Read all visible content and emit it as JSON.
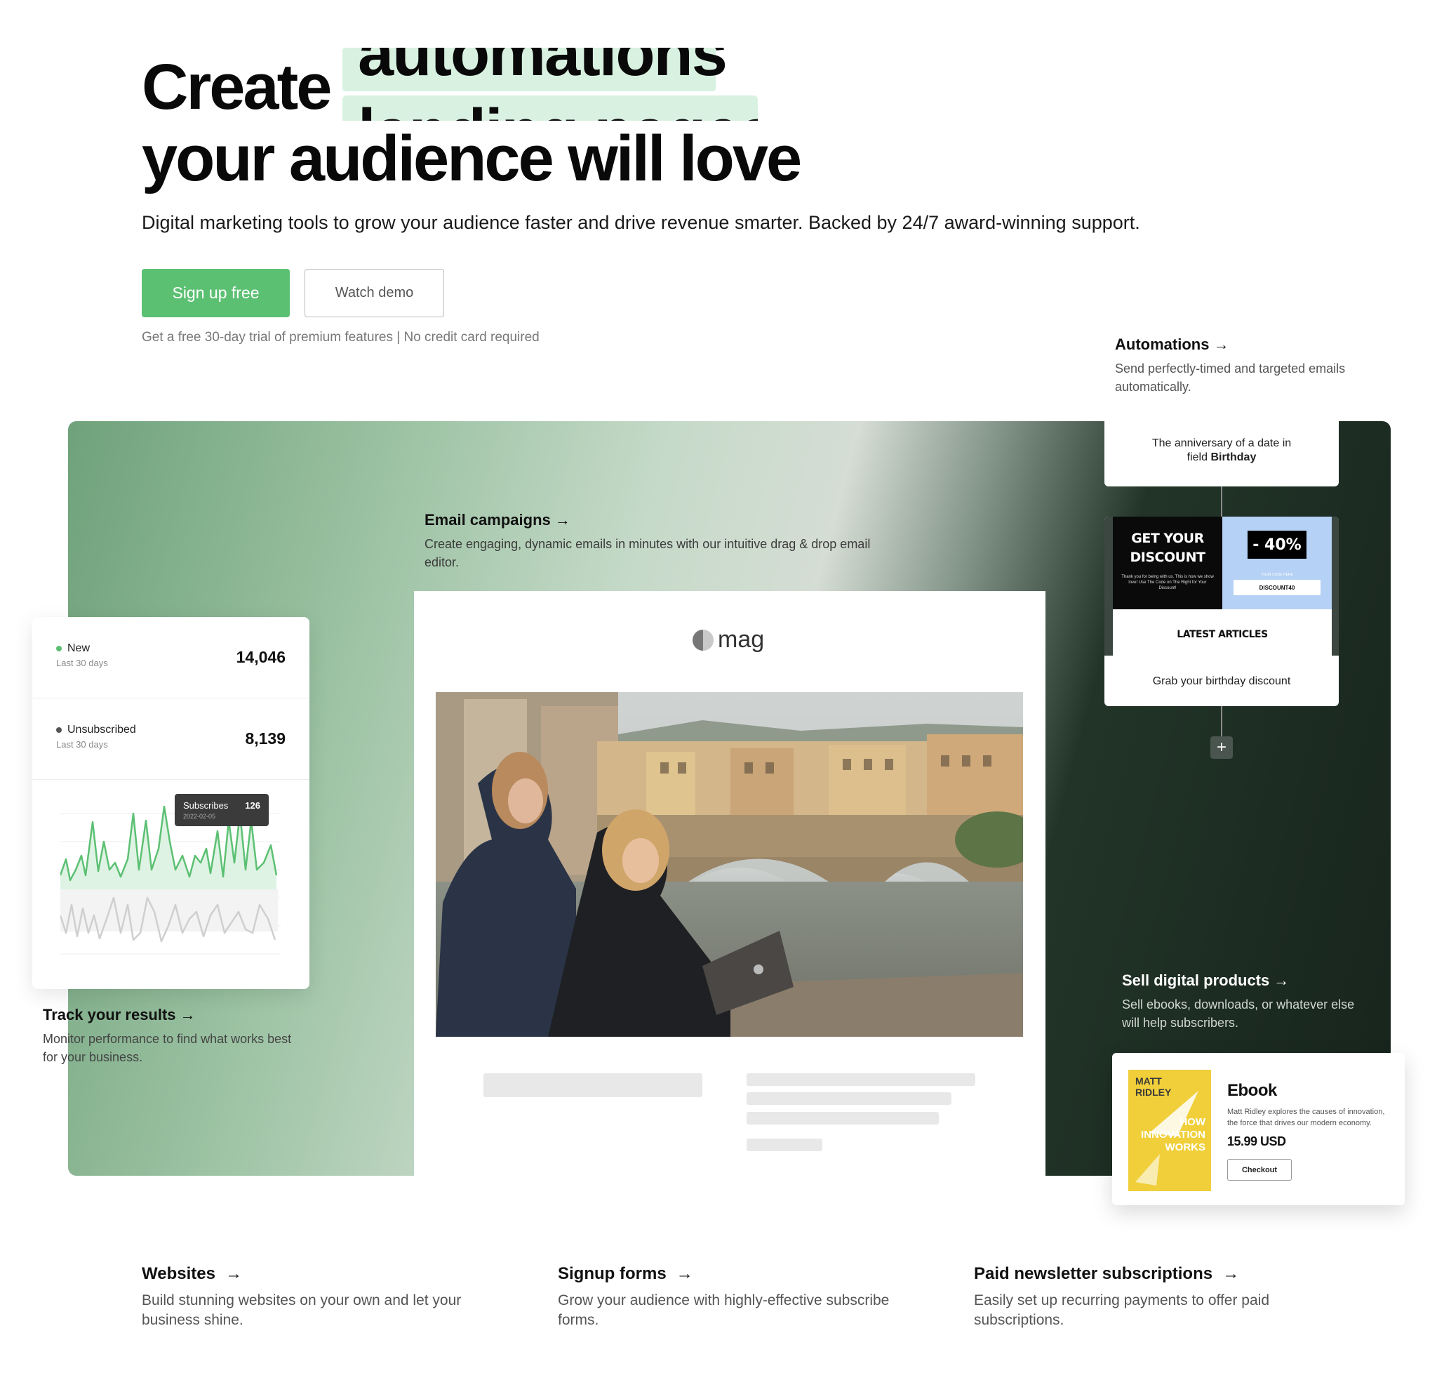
{
  "hero": {
    "title_line1": "Create",
    "rotating_word_current": "automations",
    "rotating_word_next": "landing pages",
    "title_line2": "your audience will love",
    "subtitle": "Digital marketing tools to grow your audience faster and drive revenue smarter. Backed by 24/7 award-winning support.",
    "signup_label": "Sign up free",
    "demo_label": "Watch demo",
    "trial_note": "Get a free 30-day trial of premium features | No credit card required"
  },
  "colors": {
    "accent_green": "#5cc073",
    "highlight_mint": "#d8f1e0",
    "dark_panel": "#17241d"
  },
  "features": {
    "automations": {
      "title": "Automations",
      "arrow": "→",
      "desc": "Send perfectly-timed and targeted emails automatically."
    },
    "email_campaigns": {
      "title": "Email campaigns",
      "arrow": "→",
      "desc": "Create engaging, dynamic emails in minutes with our intuitive drag & drop email editor."
    },
    "track_results": {
      "title": "Track your results",
      "arrow": "→",
      "desc": "Monitor performance to find what works best for your business."
    },
    "sell_digital": {
      "title": "Sell digital products",
      "arrow": "→",
      "desc": "Sell ebooks, downloads, or whatever else will help subscribers."
    },
    "websites": {
      "title": "Websites",
      "arrow": "→",
      "desc": "Build stunning websites on your own and let your business shine."
    },
    "signup_forms": {
      "title": "Signup forms",
      "arrow": "→",
      "desc": "Grow your audience with highly-effective subscribe forms."
    },
    "paid_newsletter": {
      "title": "Paid newsletter subscriptions",
      "arrow": "→",
      "desc": "Easily set up recurring payments to offer paid subscriptions."
    }
  },
  "email_preview": {
    "logo_text": "mag"
  },
  "stats": {
    "new_label": "New",
    "new_period": "Last 30 days",
    "new_value": "14,046",
    "new_color": "#5cc073",
    "unsub_label": "Unsubscribed",
    "unsub_period": "Last 30 days",
    "unsub_value": "8,139",
    "unsub_color": "#555555",
    "tooltip_label": "Subscribes",
    "tooltip_date": "2022-02-05",
    "tooltip_value": "126"
  },
  "automation_flow": {
    "trigger_line1": "The anniversary of a date in",
    "trigger_line2_prefix": "field ",
    "trigger_field": "Birthday",
    "promo_headline1": "GET YOUR",
    "promo_headline2": "DISCOUNT",
    "promo_small": "Thank you for being with us. This is how we show love! Use The Code on The Right for Your Discount!",
    "promo_percent": "- 40%",
    "promo_code_label": "YOUR CODE HERE",
    "promo_code": "DISCOUNT40",
    "latest_label": "LATEST ARTICLES",
    "email_caption": "Grab your birthday discount",
    "add_step": "+"
  },
  "ebook": {
    "cover_author_1": "MATT",
    "cover_author_2": "RIDLEY",
    "cover_title_1": "HOW",
    "cover_title_2": "INNOVATION",
    "cover_title_3": "WORKS",
    "title": "Ebook",
    "desc": "Matt Ridley explores the causes of innovation, the force that drives our modern economy.",
    "price": "15.99 USD",
    "checkout_label": "Checkout"
  }
}
